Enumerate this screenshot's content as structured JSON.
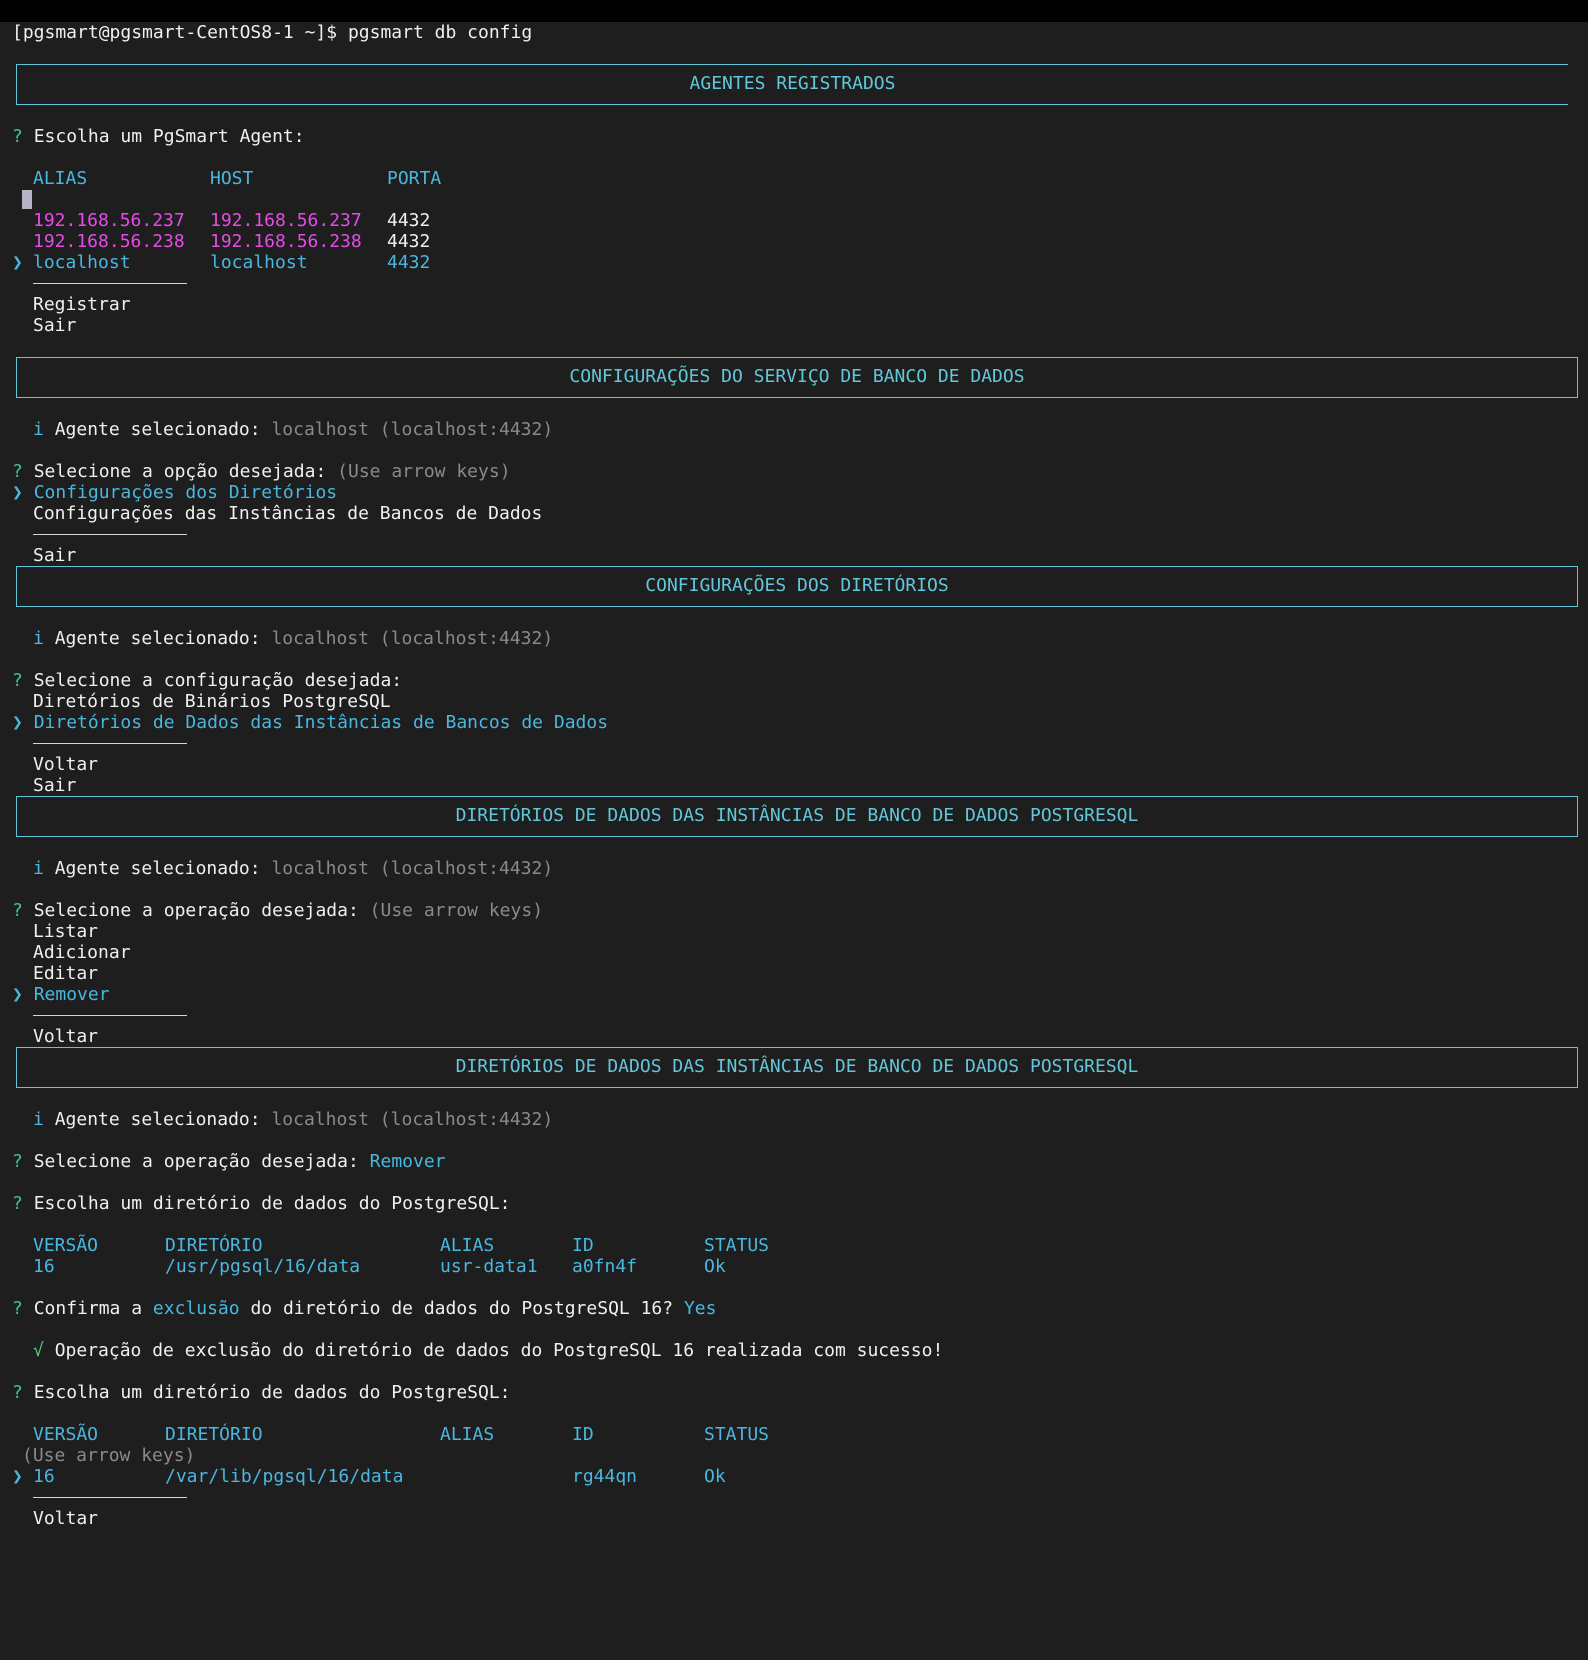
{
  "prompt_line": "[pgsmart@pgsmart-CentOS8-1 ~]$ pgsmart db config",
  "sec1": {
    "header": "AGENTES REGISTRADOS",
    "question": "Escolha um PgSmart Agent:",
    "columns": [
      "ALIAS",
      "HOST",
      "PORTA"
    ],
    "rows": [
      {
        "alias": "192.168.56.237",
        "host": "192.168.56.237",
        "port": "4432"
      },
      {
        "alias": "192.168.56.238",
        "host": "192.168.56.238",
        "port": "4432"
      },
      {
        "alias": "localhost",
        "host": "localhost",
        "port": "4432"
      }
    ],
    "actions": [
      "Registrar",
      "Sair"
    ]
  },
  "sec2": {
    "header": "CONFIGURAÇÕES DO SERVIÇO DE BANCO DE DADOS",
    "info_label": "Agente selecionado:",
    "info_value": "localhost (localhost:4432)",
    "question": "Selecione a opção desejada:",
    "hint": "(Use arrow keys)",
    "options": [
      "Configurações dos Diretórios",
      "Configurações das Instâncias de Bancos de Dados"
    ],
    "actions": [
      "Sair"
    ]
  },
  "sec3": {
    "header": "CONFIGURAÇÕES DOS DIRETÓRIOS",
    "info_label": "Agente selecionado:",
    "info_value": "localhost (localhost:4432)",
    "question": "Selecione a configuração desejada:",
    "options": [
      "Diretórios de Binários PostgreSQL",
      "Diretórios de Dados das Instâncias de Bancos de Dados"
    ],
    "actions": [
      "Voltar",
      "Sair"
    ]
  },
  "sec4": {
    "header": "DIRETÓRIOS DE DADOS DAS INSTÂNCIAS DE BANCO DE DADOS POSTGRESQL",
    "info_label": "Agente selecionado:",
    "info_value": "localhost (localhost:4432)",
    "question": "Selecione a operação desejada:",
    "hint": "(Use arrow keys)",
    "options": [
      "Listar",
      "Adicionar",
      "Editar",
      "Remover"
    ],
    "actions": [
      "Voltar"
    ]
  },
  "sec5": {
    "header": "DIRETÓRIOS DE DADOS DAS INSTÂNCIAS DE BANCO DE DADOS POSTGRESQL",
    "info_label": "Agente selecionado:",
    "info_value": "localhost (localhost:4432)",
    "question_op": "Selecione a operação desejada:",
    "answer_op": "Remover",
    "question_dir": "Escolha um diretório de dados do PostgreSQL:",
    "columns": [
      "VERSÃO",
      "DIRETÓRIO",
      "ALIAS",
      "ID",
      "STATUS"
    ],
    "row1": {
      "version": "16",
      "dir": "/usr/pgsql/16/data",
      "alias": "usr-data1",
      "id": "a0fn4f",
      "status": "Ok"
    },
    "confirm_a": "Confirma a",
    "confirm_hl": "exclusão",
    "confirm_b": "do diretório de dados do PostgreSQL 16?",
    "confirm_answer": "Yes",
    "success": "Operação de exclusão do diretório de dados do PostgreSQL 16 realizada com sucesso!",
    "question_dir2": "Escolha um diretório de dados do PostgreSQL:",
    "hint": "(Use arrow keys)",
    "row2": {
      "version": "16",
      "dir": "/var/lib/pgsql/16/data",
      "alias": "",
      "id": "rg44qn",
      "status": "Ok"
    },
    "actions": [
      "Voltar"
    ]
  },
  "symbols": {
    "question": "?",
    "pointer": "❯",
    "info": "i",
    "check": "√"
  }
}
